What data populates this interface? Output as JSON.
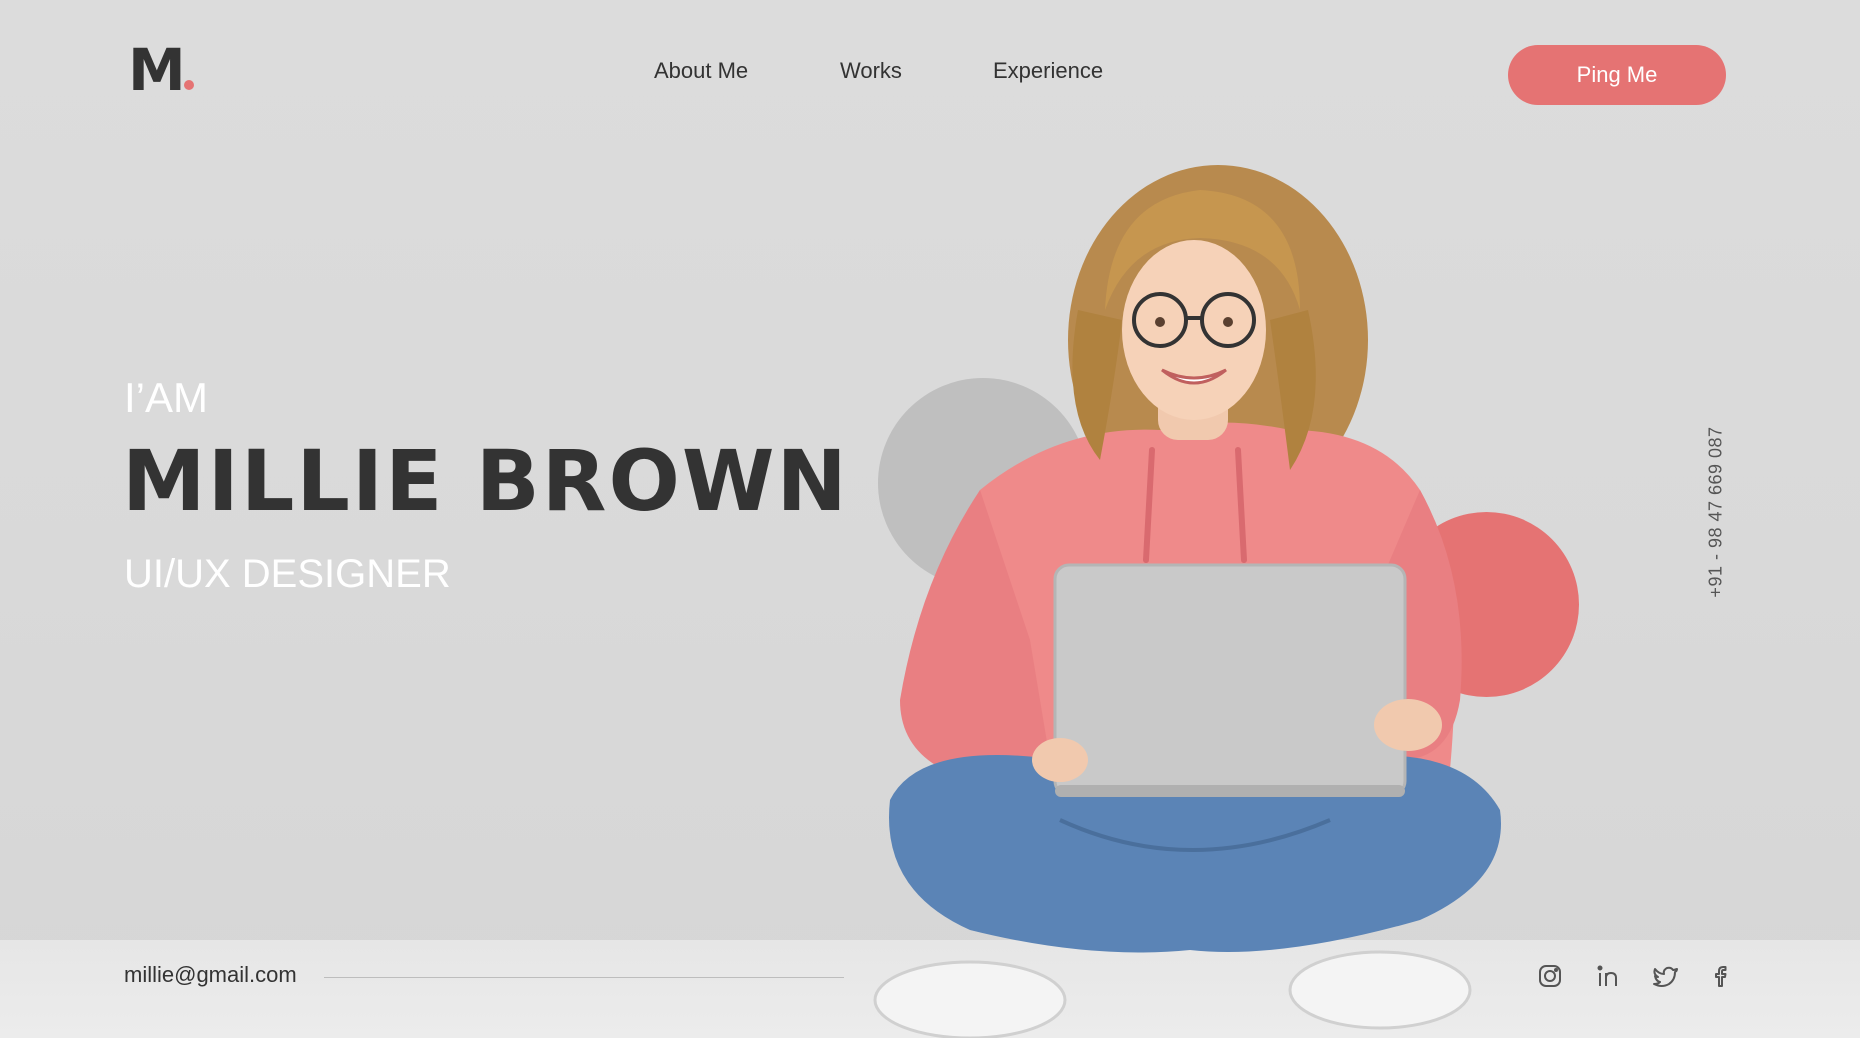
{
  "header": {
    "logo_letter": "M",
    "nav": [
      {
        "label": "About Me"
      },
      {
        "label": "Works"
      },
      {
        "label": "Experience"
      }
    ],
    "cta_label": "Ping Me"
  },
  "hero": {
    "intro": "I’AM",
    "name": "MILLIE BROWN",
    "role": "UI/UX DESIGNER"
  },
  "contact": {
    "phone": "+91 - 98 47 669 087",
    "email": "millie@gmail.com"
  },
  "social": [
    {
      "icon": "instagram-icon"
    },
    {
      "icon": "linkedin-icon"
    },
    {
      "icon": "twitter-icon"
    },
    {
      "icon": "facebook-icon"
    }
  ],
  "colors": {
    "accent": "#e57373",
    "text_dark": "#333333",
    "background": "#dcdcdc",
    "hoodie": "#ef8a8a",
    "jeans": "#5b84b6"
  }
}
